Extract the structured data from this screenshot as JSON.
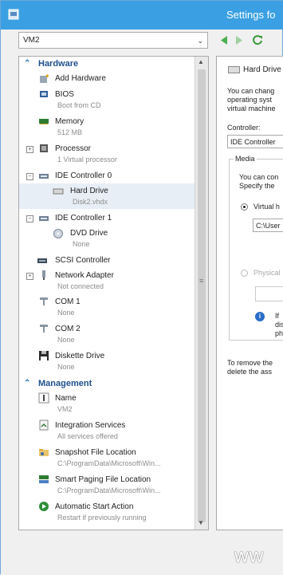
{
  "window": {
    "title": "Settings fo"
  },
  "vm_select": {
    "value": "VM2"
  },
  "tree": {
    "hardware_label": "Hardware",
    "management_label": "Management",
    "items": [
      {
        "name": "Add Hardware",
        "sub": ""
      },
      {
        "name": "BIOS",
        "sub": "Boot from CD"
      },
      {
        "name": "Memory",
        "sub": "512 MB"
      },
      {
        "name": "Processor",
        "sub": "1 Virtual processor"
      },
      {
        "name": "IDE Controller 0",
        "sub": ""
      },
      {
        "name": "Hard Drive",
        "sub": "Disk2.vhdx"
      },
      {
        "name": "IDE Controller 1",
        "sub": ""
      },
      {
        "name": "DVD Drive",
        "sub": "None"
      },
      {
        "name": "SCSI Controller",
        "sub": ""
      },
      {
        "name": "Network Adapter",
        "sub": "Not connected"
      },
      {
        "name": "COM 1",
        "sub": "None"
      },
      {
        "name": "COM 2",
        "sub": "None"
      },
      {
        "name": "Diskette Drive",
        "sub": "None"
      }
    ],
    "management": [
      {
        "name": "Name",
        "sub": "VM2"
      },
      {
        "name": "Integration Services",
        "sub": "All services offered"
      },
      {
        "name": "Snapshot File Location",
        "sub": "C:\\ProgramData\\Microsoft\\Win..."
      },
      {
        "name": "Smart Paging File Location",
        "sub": "C:\\ProgramData\\Microsoft\\Win..."
      },
      {
        "name": "Automatic Start Action",
        "sub": "Restart if previously running"
      }
    ]
  },
  "detail": {
    "header": "Hard Drive",
    "intro": [
      "You can chang",
      "operating syst",
      "virtual machine"
    ],
    "controller_label": "Controller:",
    "controller_value": "IDE Controller",
    "media_label": "Media",
    "media_text": [
      "You can con",
      "Specify the"
    ],
    "virtual_option": "Virtual h",
    "path_value": "C:\\User",
    "physical_option": "Physical",
    "info_text": [
      "If",
      "dis",
      "ph"
    ],
    "remove_text": [
      "To remove the",
      "delete the ass"
    ]
  },
  "watermark": "ww"
}
